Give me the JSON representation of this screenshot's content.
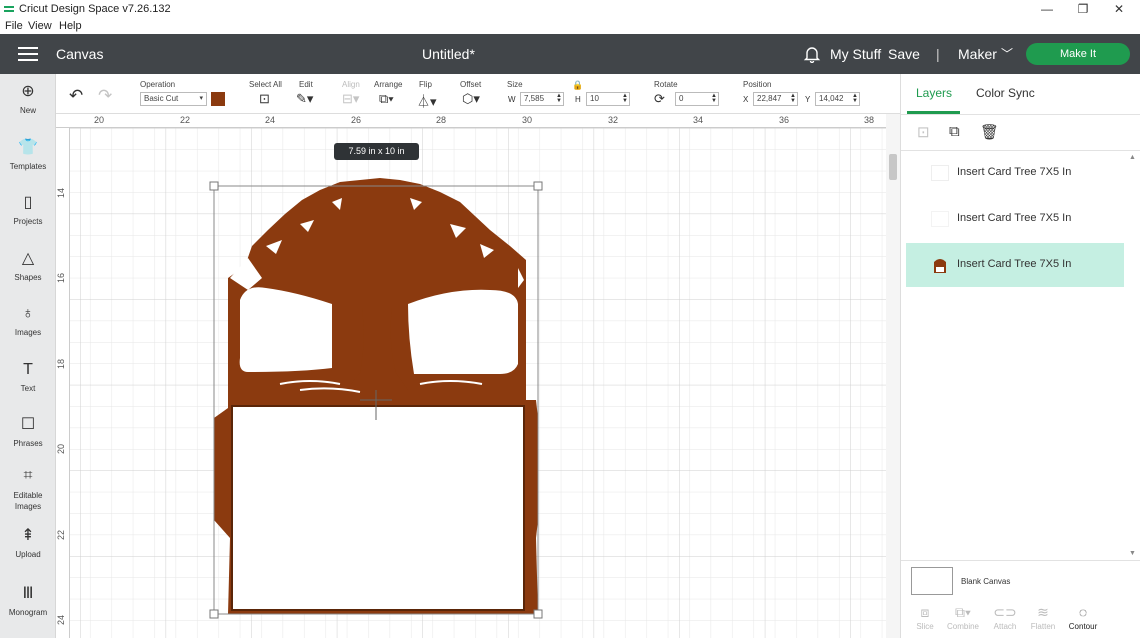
{
  "window": {
    "title": "Cricut Design Space  v7.26.132",
    "minimize": "—",
    "restore": "❐",
    "close": "✕"
  },
  "menu": [
    "File",
    "View",
    "Help"
  ],
  "header": {
    "section": "Canvas",
    "doc_title": "Untitled*",
    "my_stuff": "My Stuff",
    "save": "Save",
    "separator": "|",
    "machine": "Maker",
    "make_it": "Make It",
    "accent": "#1f9b4f",
    "bg": "#414549"
  },
  "sidebar": [
    {
      "label": "New",
      "icon": "plus-circle-icon"
    },
    {
      "label": "Templates",
      "icon": "shirt-icon"
    },
    {
      "label": "Projects",
      "icon": "clipboard-icon"
    },
    {
      "label": "Shapes",
      "icon": "shapes-icon"
    },
    {
      "label": "Images",
      "icon": "lightbulb-icon"
    },
    {
      "label": "Text",
      "icon": "text-icon"
    },
    {
      "label": "Phrases",
      "icon": "chat-icon"
    },
    {
      "label": "Editable Images",
      "icon": "editable-icon"
    },
    {
      "label": "Upload",
      "icon": "upload-icon"
    },
    {
      "label": "Monogram",
      "icon": "monogram-icon"
    }
  ],
  "toolbar": {
    "operation_label": "Operation",
    "operation_value": "Basic Cut",
    "operation_color": "#8b3a0f",
    "select_all": "Select All",
    "edit": "Edit",
    "align": "Align",
    "arrange": "Arrange",
    "flip": "Flip",
    "offset": "Offset",
    "size": "Size",
    "w_label": "W",
    "w_value": "7,585",
    "h_label": "H",
    "h_value": "10",
    "rotate": "Rotate",
    "rotate_value": "0",
    "position": "Position",
    "x_label": "X",
    "x_value": "22,847",
    "y_label": "Y",
    "y_value": "14,042"
  },
  "canvas": {
    "ruler_top": [
      "20",
      "22",
      "24",
      "26",
      "28",
      "30",
      "32",
      "34",
      "36",
      "38"
    ],
    "ruler_left": [
      "14",
      "16",
      "18",
      "20",
      "22",
      "24"
    ],
    "size_tooltip": "7.59  in x 10  in",
    "fill_color": "#8b3a0f"
  },
  "right_panel": {
    "tabs": [
      "Layers",
      "Color Sync"
    ],
    "layers": [
      {
        "name": "Insert Card Tree 7X5 In",
        "selected": false
      },
      {
        "name": "Insert Card Tree 7X5 In",
        "selected": false
      },
      {
        "name": "Insert Card Tree 7X5 In",
        "selected": true
      }
    ],
    "blank_canvas": "Blank Canvas",
    "bottom_tools": [
      "Slice",
      "Combine",
      "Attach",
      "Flatten",
      "Contour"
    ]
  }
}
